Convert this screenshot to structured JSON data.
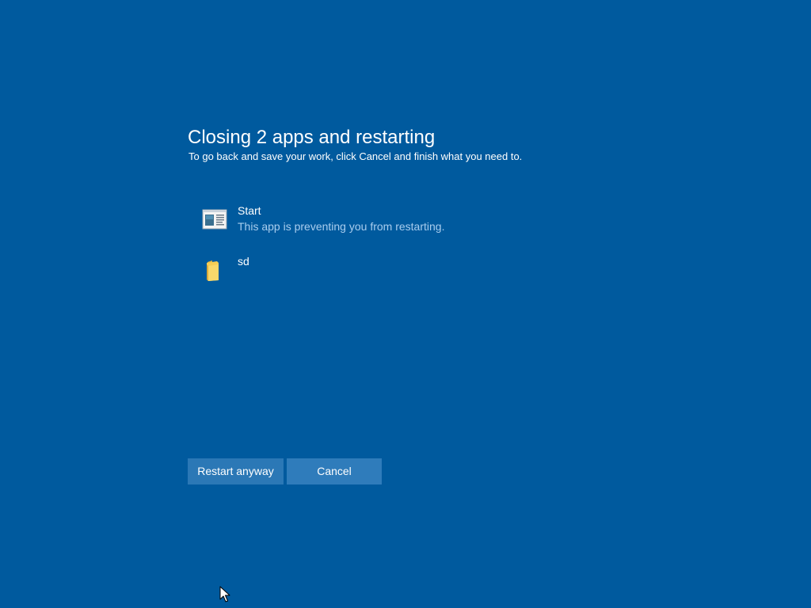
{
  "dialog": {
    "title": "Closing 2 apps and restarting",
    "subtitle": "To go back and save your work, click Cancel and finish what you need to."
  },
  "apps": [
    {
      "name": "Start",
      "status": "This app is preventing you from restarting.",
      "icon": "start-app-icon"
    },
    {
      "name": "sd",
      "status": "",
      "icon": "folder-icon"
    }
  ],
  "buttons": {
    "restart_label": "Restart anyway",
    "cancel_label": "Cancel"
  },
  "colors": {
    "background": "#005a9e",
    "button": "#2b78b6",
    "status_text": "#a9cdee"
  }
}
